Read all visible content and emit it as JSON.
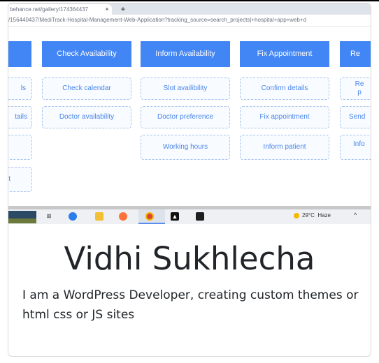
{
  "browser": {
    "tab_title": "behance.net/gallery/174364437",
    "tab_close": "×",
    "new_tab": "+",
    "url": "/156440437/MediTrack-Hospital-Management-Web-Application?tracking_source=search_projects|+hospital+app+web+d"
  },
  "flowchart": {
    "headers": [
      "",
      "Check Availability",
      "Inform Availability",
      "Fix Appointment",
      "Re"
    ],
    "col0": [
      "ls",
      "tails",
      "",
      "t"
    ],
    "col1": [
      "Check calendar",
      "Doctor availability"
    ],
    "col2": [
      "Slot availibility",
      "Doctor preference",
      "Working hours"
    ],
    "col3": [
      "Confirm details",
      "Fix appointment",
      "Inform patient"
    ],
    "col4": [
      "Re",
      "p",
      "Send",
      "Info"
    ]
  },
  "taskbar": {
    "weather_temp": "29°C",
    "weather_desc": "Haze",
    "tray_chevron": "^"
  },
  "profile": {
    "name": "Vidhi Sukhlecha",
    "bio": "I am a WordPress Developer, creating custom themes or html css or JS sites"
  },
  "colors": {
    "accent_blue": "#4285f4",
    "cell_text": "#4a86e8"
  }
}
